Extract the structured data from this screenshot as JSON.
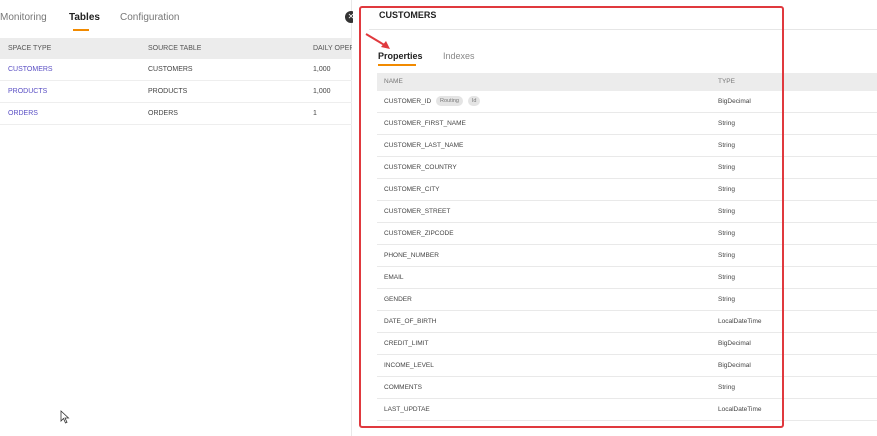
{
  "left": {
    "tabs": [
      "Monitoring",
      "Tables",
      "Configuration"
    ],
    "active_tab": "Tables",
    "columns": [
      "SPACE TYPE",
      "SOURCE TABLE",
      "DAILY OPERA"
    ],
    "rows": [
      {
        "space_type": "CUSTOMERS",
        "source_table": "CUSTOMERS",
        "daily": "1,000"
      },
      {
        "space_type": "PRODUCTS",
        "source_table": "PRODUCTS",
        "daily": "1,000"
      },
      {
        "space_type": "ORDERS",
        "source_table": "ORDERS",
        "daily": "1"
      }
    ]
  },
  "drawer": {
    "close_icon": "close-icon",
    "title": "CUSTOMERS",
    "tabs": [
      "Properties",
      "Indexes"
    ],
    "active_tab": "Properties",
    "columns": [
      "NAME",
      "TYPE"
    ],
    "properties": [
      {
        "name": "CUSTOMER_ID",
        "badges": [
          "Routing",
          "Id"
        ],
        "type": "BigDecimal"
      },
      {
        "name": "CUSTOMER_FIRST_NAME",
        "type": "String"
      },
      {
        "name": "CUSTOMER_LAST_NAME",
        "type": "String"
      },
      {
        "name": "CUSTOMER_COUNTRY",
        "type": "String"
      },
      {
        "name": "CUSTOMER_CITY",
        "type": "String"
      },
      {
        "name": "CUSTOMER_STREET",
        "type": "String"
      },
      {
        "name": "CUSTOMER_ZIPCODE",
        "type": "String"
      },
      {
        "name": "PHONE_NUMBER",
        "type": "String"
      },
      {
        "name": "EMAIL",
        "type": "String"
      },
      {
        "name": "GENDER",
        "type": "String"
      },
      {
        "name": "DATE_OF_BIRTH",
        "type": "LocalDateTime"
      },
      {
        "name": "CREDIT_LIMIT",
        "type": "BigDecimal"
      },
      {
        "name": "INCOME_LEVEL",
        "type": "BigDecimal"
      },
      {
        "name": "COMMENTS",
        "type": "String"
      },
      {
        "name": "LAST_UPDTAE",
        "type": "LocalDateTime"
      }
    ]
  },
  "colors": {
    "accent": "#f18a00",
    "link": "#5a4fc4",
    "annotation": "#e0393e"
  }
}
